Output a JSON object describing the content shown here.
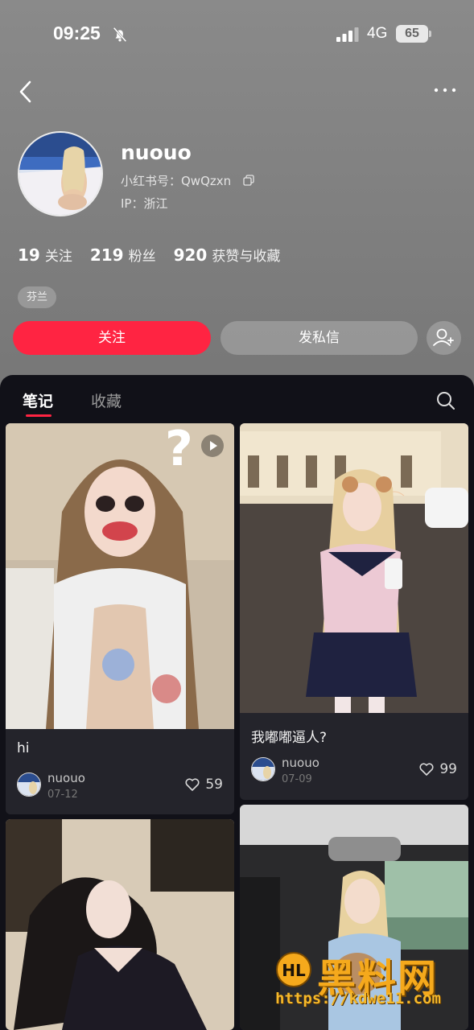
{
  "status_bar": {
    "time": "09:25",
    "network": "4G",
    "battery": "65"
  },
  "profile": {
    "username": "nuouo",
    "red_id": "小红书号：QwQzxn",
    "ip": "IP：浙江",
    "stats": [
      {
        "num": "19",
        "label": "关注"
      },
      {
        "num": "219",
        "label": "粉丝"
      },
      {
        "num": "920",
        "label": "获赞与收藏"
      }
    ],
    "tag": "芬兰",
    "follow_label": "关注",
    "message_label": "发私信"
  },
  "tabs": {
    "notes": "笔记",
    "collections": "收藏"
  },
  "notes": [
    {
      "title": "hi",
      "author": "nuouo",
      "date": "07-12",
      "likes": "59"
    },
    {
      "title": "我嘟嘟逼人?",
      "author": "nuouo",
      "date": "07-09",
      "likes": "99"
    }
  ],
  "watermark": {
    "logo_text": "HL",
    "brand": "黑料网",
    "url": "https://kdwe11.com"
  },
  "colors": {
    "accent": "#ff2442",
    "background_dark": "#111118",
    "card": "#24242b"
  },
  "icons": [
    "back-icon",
    "more-icon",
    "copy-icon",
    "add-user-icon",
    "search-icon",
    "heart-icon",
    "play-icon",
    "bell-off-icon",
    "signal-icon"
  ]
}
